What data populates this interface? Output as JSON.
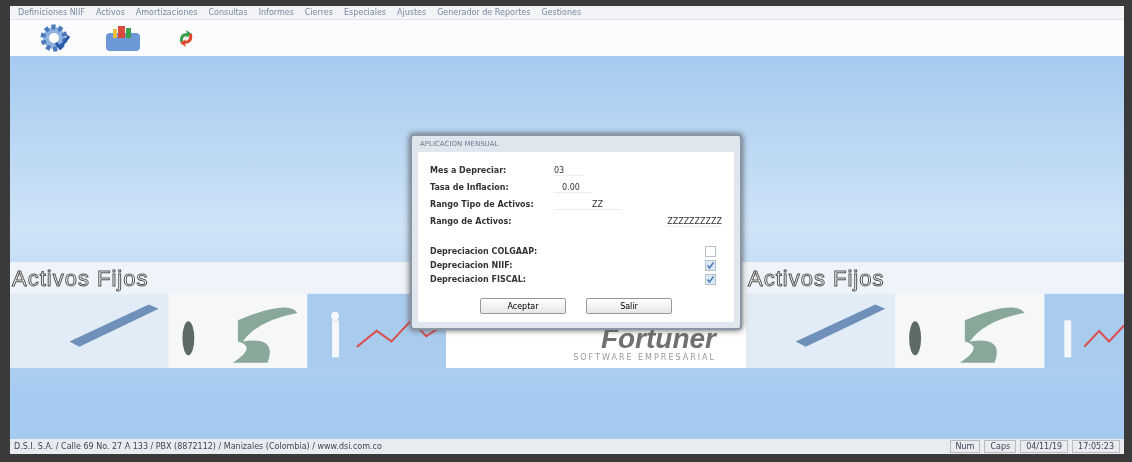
{
  "menu": [
    "Definiciones NIIF",
    "Activos",
    "Amortizaciones",
    "Consultas",
    "Informes",
    "Cierres",
    "Especiales",
    "Ajustes",
    "Generador de Reportes",
    "Gestiones"
  ],
  "banner": {
    "title_left": "Activos Fijos",
    "title_right": "Activos Fijos",
    "logo": "Fortuner",
    "logo_subtitle": "SOFTWARE EMPRESARIAL"
  },
  "dialog": {
    "title": "APLICACION MENSUAL",
    "fields": [
      {
        "label": "Mes a Depreciar:",
        "value": "03"
      },
      {
        "label": "Tasa de Inflacion:",
        "value": "0.00"
      },
      {
        "label": "Rango Tipo de Activos:",
        "value": "ZZ"
      },
      {
        "label": "Rango de Activos:",
        "value": "ZZZZZZZZZZ"
      }
    ],
    "options": [
      {
        "label": "Depreciacion COLGAAP:",
        "checked": false
      },
      {
        "label": "Depreciacion NIIF:",
        "checked": true
      },
      {
        "label": "Depreciacion FISCAL:",
        "checked": true
      }
    ],
    "buttons": [
      "Aceptar",
      "Salir"
    ]
  },
  "status_bar": {
    "address": "D.S.I. S.A. / Calle 69 No. 27 A 133 / PBX (8872112) / Manizales (Colombia) / www.dsi.com.co",
    "panels": [
      "Num",
      "Caps",
      "04/11/19",
      "17:05:23"
    ]
  }
}
